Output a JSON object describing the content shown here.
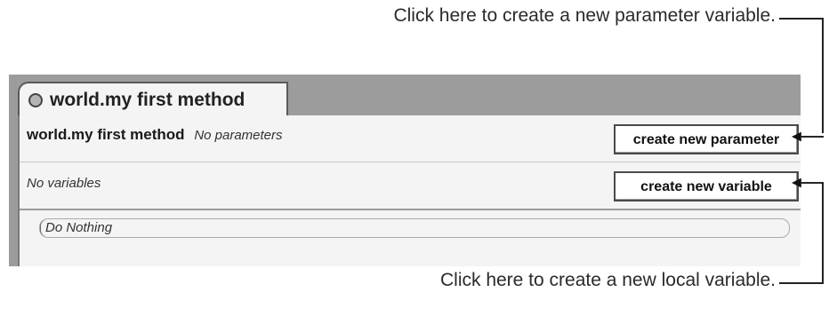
{
  "callouts": {
    "top": "Click here to create a new parameter variable.",
    "bottom": "Click here to create a new local variable."
  },
  "tab": {
    "title": "world.my first method"
  },
  "method": {
    "name": "world.my first method",
    "params_text": "No parameters",
    "variables_text": "No variables",
    "create_parameter_label": "create new parameter",
    "create_variable_label": "create new variable",
    "body_statement": "Do Nothing"
  },
  "colors": {
    "frame": "#9c9c9c",
    "panel": "#f4f4f4",
    "button": "#ffffff"
  }
}
